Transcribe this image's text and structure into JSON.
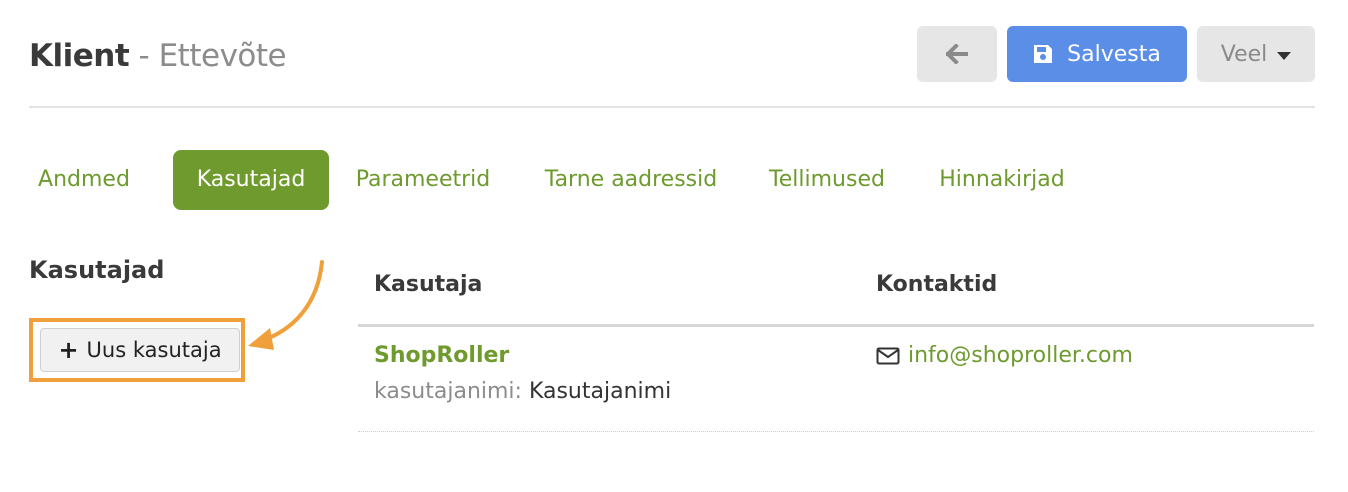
{
  "header": {
    "title_main": "Klient",
    "title_sep": " - ",
    "title_sub": "Ettevõte",
    "save_label": "Salvesta",
    "more_label": "Veel",
    "back_icon": "arrow-left-icon",
    "save_icon": "floppy-disk-icon",
    "more_icon": "caret-down-icon"
  },
  "tabs": [
    {
      "label": "Andmed",
      "active": false
    },
    {
      "label": "Kasutajad",
      "active": true
    },
    {
      "label": "Parameetrid",
      "active": false
    },
    {
      "label": "Tarne aadressid",
      "active": false
    },
    {
      "label": "Tellimused",
      "active": false
    },
    {
      "label": "Hinnakirjad",
      "active": false
    }
  ],
  "sidebar": {
    "title": "Kasutajad",
    "new_user_label": "Uus kasutaja",
    "new_user_icon": "plus-icon"
  },
  "table": {
    "columns": [
      "Kasutaja",
      "Kontaktid"
    ],
    "rows": [
      {
        "name": "ShopRoller",
        "username_label": "kasutajanimi:",
        "username_value": "Kasutajanimi",
        "email": "info@shoproller.com",
        "email_icon": "envelope-icon"
      }
    ]
  },
  "colors": {
    "brand_green": "#6e9a2e",
    "primary_blue": "#5b8ee6",
    "highlight_orange": "#f0a03a",
    "button_grey": "#e6e6e6"
  }
}
